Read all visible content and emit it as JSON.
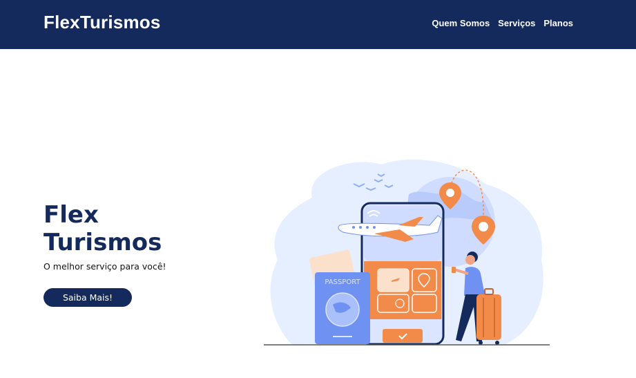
{
  "header": {
    "brand": "FlexTurismos",
    "nav": [
      "Quem Somos",
      "Serviços",
      "Planos"
    ]
  },
  "hero": {
    "title": "Flex Turismos",
    "subtitle": "O melhor serviço para você!",
    "cta_label": "Saiba Mais!"
  },
  "illustration": {
    "passport_label": "PASSPORT"
  },
  "colors": {
    "navy": "#142a5c",
    "orange": "#f28a4a",
    "blue": "#6f92f2",
    "light_blue": "#e6efff"
  }
}
